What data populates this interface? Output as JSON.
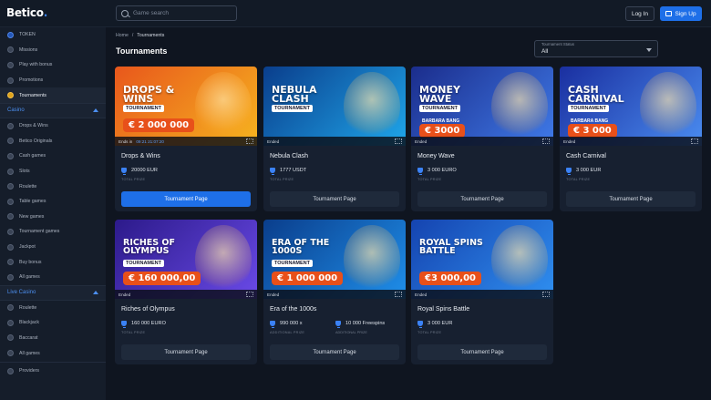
{
  "brand": {
    "logo": "Betico",
    "accent": "#1e6fe8"
  },
  "header": {
    "search_placeholder": "Game search",
    "login_label": "Log In",
    "signup_label": "Sign Up"
  },
  "sidebar": {
    "top_items": [
      {
        "label": "TOKEN",
        "icon": "token-icon"
      },
      {
        "label": "Missions",
        "icon": "missions-icon"
      },
      {
        "label": "Play with bonus",
        "icon": "bonus-icon"
      },
      {
        "label": "Promotions",
        "icon": "promotions-icon"
      },
      {
        "label": "Tournaments",
        "icon": "trophy-icon"
      }
    ],
    "casino_label": "Casino",
    "casino_items": [
      {
        "label": "Drops & Wins"
      },
      {
        "label": "Betico Originals"
      },
      {
        "label": "Cash games"
      },
      {
        "label": "Slots"
      },
      {
        "label": "Roulette"
      },
      {
        "label": "Table games"
      },
      {
        "label": "New games"
      },
      {
        "label": "Tournament games"
      },
      {
        "label": "Jackpot"
      },
      {
        "label": "Buy bonus"
      },
      {
        "label": "All games"
      }
    ],
    "live_label": "Live Casino",
    "live_items": [
      {
        "label": "Roulette"
      },
      {
        "label": "Blackjack"
      },
      {
        "label": "Baccarat"
      },
      {
        "label": "All games"
      }
    ],
    "providers_label": "Providers"
  },
  "breadcrumb": {
    "home": "Home",
    "sep": "/",
    "current": "Tournaments"
  },
  "page_title": "Tournaments",
  "status_filter": {
    "label": "Tournament Status",
    "value": "All"
  },
  "cards": [
    {
      "name": "Drops & Wins",
      "headline": "DROPS & WINS",
      "sub": "TOURNAMENT",
      "amount": "€ 2 000 000",
      "status": "Ends in",
      "countdown": "09:21 21:07:20",
      "prize_value": "20000 EUR",
      "prize_label": "TOTAL PRIZE",
      "button": "Tournament Page",
      "bg1": "#e8571c",
      "bg2": "#f6b41f"
    },
    {
      "name": "Nebula Clash",
      "headline": "NEBULA CLASH",
      "sub": "TOURNAMENT",
      "amount": "",
      "status": "Ended",
      "prize_value": "1777 USDT",
      "prize_label": "TOTAL PRIZE",
      "button": "Tournament Page",
      "bg1": "#0a3e8c",
      "bg2": "#1fa6ea"
    },
    {
      "name": "Money Wave",
      "headline": "MONEY WAVE",
      "sub": "TOURNAMENT",
      "extra": "BARBARA BANG",
      "amount": "€ 3000",
      "status": "Ended",
      "prize_value": "3 000 EURO",
      "prize_label": "TOTAL PRIZE",
      "button": "Tournament Page",
      "bg1": "#1b2d8c",
      "bg2": "#3f7ae8"
    },
    {
      "name": "Cash Carnival",
      "headline": "CASH CARNIVAL",
      "sub": "TOURNAMENT",
      "amount": "€ 3 000",
      "extra": "BARBARA BANG",
      "status": "Ended",
      "prize_value": "3 000 EUR",
      "prize_label": "TOTAL PRIZE",
      "button": "Tournament Page",
      "bg1": "#1a2fa0",
      "bg2": "#4a8cf0"
    },
    {
      "name": "Riches of Olympus",
      "headline": "RICHES OF OLYMPUS",
      "sub": "TOURNAMENT",
      "amount": "€ 160 000,00",
      "status": "Ended",
      "prize_value": "160 000 EURO",
      "prize_label": "TOTAL PRIZE",
      "button": "Tournament Page",
      "bg1": "#2c1a8a",
      "bg2": "#6a4ae8"
    },
    {
      "name": "Era of the 1000s",
      "headline": "ERA OF THE 1000S",
      "sub": "TOURNAMENT",
      "amount": "€ 1 000 000",
      "status": "Ended",
      "prize_value": "990 000 x",
      "prize_label": "ADDITIONAL PRIZE",
      "prize_value_2": "10 000 Freespins",
      "prize_label_2": "ADDITIONAL PRIZE",
      "button": "Tournament Page",
      "bg1": "#0a3e8c",
      "bg2": "#1f8fea"
    },
    {
      "name": "Royal Spins Battle",
      "headline": "ROYAL SPINS BATTLE",
      "sub": "",
      "amount": "€3 000,00",
      "status": "Ended",
      "prize_value": "3 000 EUR",
      "prize_label": "TOTAL PRIZE",
      "button": "Tournament Page",
      "bg1": "#1544b0",
      "bg2": "#2f8ff0"
    }
  ]
}
